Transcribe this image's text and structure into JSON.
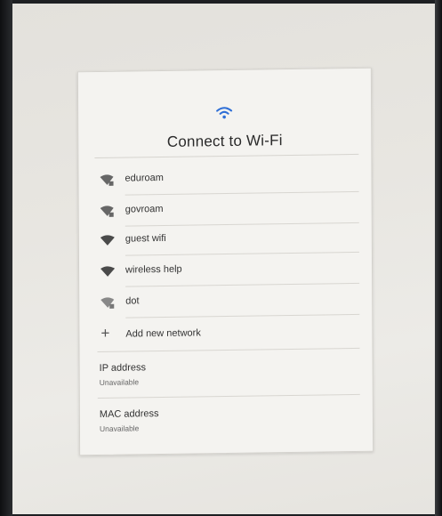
{
  "dialog": {
    "title": "Connect to Wi-Fi",
    "accent_color": "#2f6fd6",
    "header_icon": "wifi-icon"
  },
  "networks": [
    {
      "name": "eduroam",
      "icon": "wifi-lock-icon",
      "secured": true
    },
    {
      "name": "govroam",
      "icon": "wifi-lock-icon",
      "secured": true
    },
    {
      "name": "guest wifi",
      "icon": "wifi-icon",
      "secured": false
    },
    {
      "name": "wireless help",
      "icon": "wifi-icon",
      "secured": false
    },
    {
      "name": "dot",
      "icon": "wifi-lock-icon",
      "secured": true
    }
  ],
  "add_network": {
    "label": "Add new network",
    "icon": "plus-icon"
  },
  "ip_address": {
    "label": "IP address",
    "value": "Unavailable"
  },
  "mac_address": {
    "label": "MAC address",
    "value": "Unavailable"
  }
}
